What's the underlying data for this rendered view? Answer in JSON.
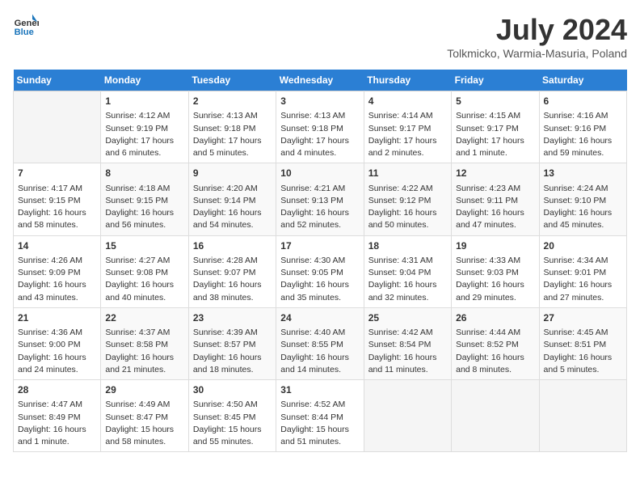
{
  "header": {
    "logo_line1": "General",
    "logo_line2": "Blue",
    "month_title": "July 2024",
    "location": "Tolkmicko, Warmia-Masuria, Poland"
  },
  "days_of_week": [
    "Sunday",
    "Monday",
    "Tuesday",
    "Wednesday",
    "Thursday",
    "Friday",
    "Saturday"
  ],
  "weeks": [
    [
      {
        "day": "",
        "info": ""
      },
      {
        "day": "1",
        "info": "Sunrise: 4:12 AM\nSunset: 9:19 PM\nDaylight: 17 hours\nand 6 minutes."
      },
      {
        "day": "2",
        "info": "Sunrise: 4:13 AM\nSunset: 9:18 PM\nDaylight: 17 hours\nand 5 minutes."
      },
      {
        "day": "3",
        "info": "Sunrise: 4:13 AM\nSunset: 9:18 PM\nDaylight: 17 hours\nand 4 minutes."
      },
      {
        "day": "4",
        "info": "Sunrise: 4:14 AM\nSunset: 9:17 PM\nDaylight: 17 hours\nand 2 minutes."
      },
      {
        "day": "5",
        "info": "Sunrise: 4:15 AM\nSunset: 9:17 PM\nDaylight: 17 hours\nand 1 minute."
      },
      {
        "day": "6",
        "info": "Sunrise: 4:16 AM\nSunset: 9:16 PM\nDaylight: 16 hours\nand 59 minutes."
      }
    ],
    [
      {
        "day": "7",
        "info": "Sunrise: 4:17 AM\nSunset: 9:15 PM\nDaylight: 16 hours\nand 58 minutes."
      },
      {
        "day": "8",
        "info": "Sunrise: 4:18 AM\nSunset: 9:15 PM\nDaylight: 16 hours\nand 56 minutes."
      },
      {
        "day": "9",
        "info": "Sunrise: 4:20 AM\nSunset: 9:14 PM\nDaylight: 16 hours\nand 54 minutes."
      },
      {
        "day": "10",
        "info": "Sunrise: 4:21 AM\nSunset: 9:13 PM\nDaylight: 16 hours\nand 52 minutes."
      },
      {
        "day": "11",
        "info": "Sunrise: 4:22 AM\nSunset: 9:12 PM\nDaylight: 16 hours\nand 50 minutes."
      },
      {
        "day": "12",
        "info": "Sunrise: 4:23 AM\nSunset: 9:11 PM\nDaylight: 16 hours\nand 47 minutes."
      },
      {
        "day": "13",
        "info": "Sunrise: 4:24 AM\nSunset: 9:10 PM\nDaylight: 16 hours\nand 45 minutes."
      }
    ],
    [
      {
        "day": "14",
        "info": "Sunrise: 4:26 AM\nSunset: 9:09 PM\nDaylight: 16 hours\nand 43 minutes."
      },
      {
        "day": "15",
        "info": "Sunrise: 4:27 AM\nSunset: 9:08 PM\nDaylight: 16 hours\nand 40 minutes."
      },
      {
        "day": "16",
        "info": "Sunrise: 4:28 AM\nSunset: 9:07 PM\nDaylight: 16 hours\nand 38 minutes."
      },
      {
        "day": "17",
        "info": "Sunrise: 4:30 AM\nSunset: 9:05 PM\nDaylight: 16 hours\nand 35 minutes."
      },
      {
        "day": "18",
        "info": "Sunrise: 4:31 AM\nSunset: 9:04 PM\nDaylight: 16 hours\nand 32 minutes."
      },
      {
        "day": "19",
        "info": "Sunrise: 4:33 AM\nSunset: 9:03 PM\nDaylight: 16 hours\nand 29 minutes."
      },
      {
        "day": "20",
        "info": "Sunrise: 4:34 AM\nSunset: 9:01 PM\nDaylight: 16 hours\nand 27 minutes."
      }
    ],
    [
      {
        "day": "21",
        "info": "Sunrise: 4:36 AM\nSunset: 9:00 PM\nDaylight: 16 hours\nand 24 minutes."
      },
      {
        "day": "22",
        "info": "Sunrise: 4:37 AM\nSunset: 8:58 PM\nDaylight: 16 hours\nand 21 minutes."
      },
      {
        "day": "23",
        "info": "Sunrise: 4:39 AM\nSunset: 8:57 PM\nDaylight: 16 hours\nand 18 minutes."
      },
      {
        "day": "24",
        "info": "Sunrise: 4:40 AM\nSunset: 8:55 PM\nDaylight: 16 hours\nand 14 minutes."
      },
      {
        "day": "25",
        "info": "Sunrise: 4:42 AM\nSunset: 8:54 PM\nDaylight: 16 hours\nand 11 minutes."
      },
      {
        "day": "26",
        "info": "Sunrise: 4:44 AM\nSunset: 8:52 PM\nDaylight: 16 hours\nand 8 minutes."
      },
      {
        "day": "27",
        "info": "Sunrise: 4:45 AM\nSunset: 8:51 PM\nDaylight: 16 hours\nand 5 minutes."
      }
    ],
    [
      {
        "day": "28",
        "info": "Sunrise: 4:47 AM\nSunset: 8:49 PM\nDaylight: 16 hours\nand 1 minute."
      },
      {
        "day": "29",
        "info": "Sunrise: 4:49 AM\nSunset: 8:47 PM\nDaylight: 15 hours\nand 58 minutes."
      },
      {
        "day": "30",
        "info": "Sunrise: 4:50 AM\nSunset: 8:45 PM\nDaylight: 15 hours\nand 55 minutes."
      },
      {
        "day": "31",
        "info": "Sunrise: 4:52 AM\nSunset: 8:44 PM\nDaylight: 15 hours\nand 51 minutes."
      },
      {
        "day": "",
        "info": ""
      },
      {
        "day": "",
        "info": ""
      },
      {
        "day": "",
        "info": ""
      }
    ]
  ]
}
